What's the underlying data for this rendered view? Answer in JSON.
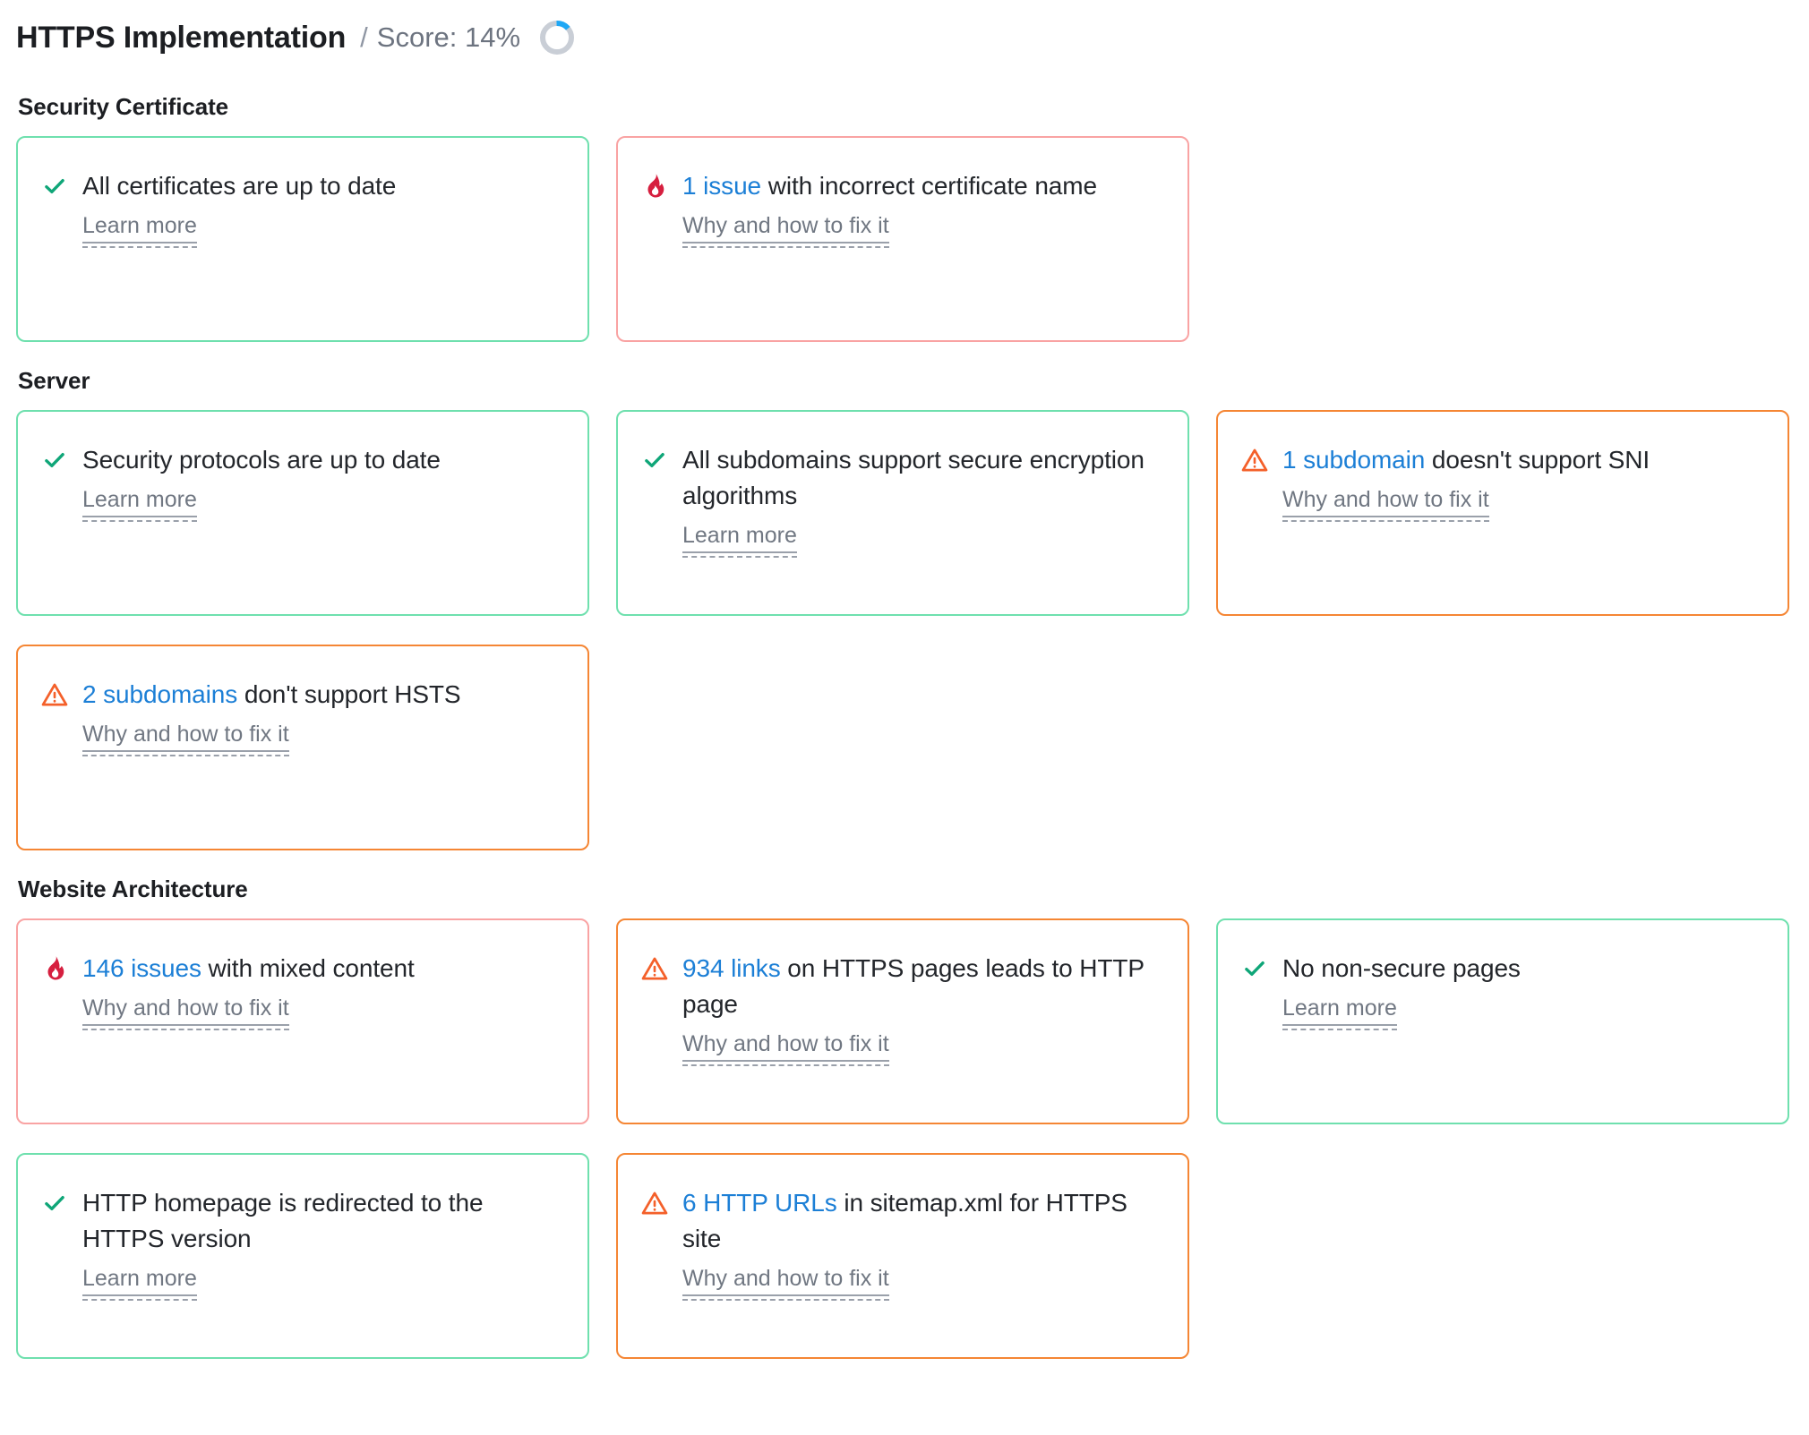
{
  "header": {
    "title": "HTTPS Implementation",
    "separator": "/",
    "score_label": "Score: 14%",
    "score_percent": 14,
    "ring_track_color": "#c9ced6",
    "ring_value_color": "#1ea7f5"
  },
  "colors": {
    "ok_border": "#6fe0ae",
    "error_border": "#f9a3a3",
    "warn_border": "#f58634",
    "check_icon": "#0fa678",
    "flame_icon": "#d61f3f",
    "warn_icon": "#f4602a",
    "link_blue": "#1c7fd6",
    "text_dark": "#23262b",
    "text_muted": "#707782"
  },
  "links": {
    "learn_more": "Learn more",
    "why_and_how": "Why and how to fix it"
  },
  "sections": [
    {
      "title": "Security Certificate",
      "cards": [
        {
          "status": "ok",
          "icon": "check-icon",
          "count": "",
          "text": "All certificates are up to date",
          "link": "Learn more"
        },
        {
          "status": "error",
          "icon": "flame-icon",
          "count": "1 issue",
          "text": " with incorrect certificate name",
          "link": "Why and how to fix it"
        }
      ]
    },
    {
      "title": "Server",
      "cards": [
        {
          "status": "ok",
          "icon": "check-icon",
          "count": "",
          "text": "Security protocols are up to date",
          "link": "Learn more"
        },
        {
          "status": "ok",
          "icon": "check-icon",
          "count": "",
          "text": "All subdomains support secure encryption algorithms",
          "link": "Learn more"
        },
        {
          "status": "warn",
          "icon": "warning-triangle-icon",
          "count": "1 subdomain",
          "text": " doesn't support SNI",
          "link": "Why and how to fix it"
        },
        {
          "status": "warn",
          "icon": "warning-triangle-icon",
          "count": "2 subdomains",
          "text": " don't support HSTS",
          "link": "Why and how to fix it"
        }
      ]
    },
    {
      "title": "Website Architecture",
      "cards": [
        {
          "status": "error",
          "icon": "flame-icon",
          "count": "146 issues",
          "text": " with mixed content",
          "link": "Why and how to fix it"
        },
        {
          "status": "warn",
          "icon": "warning-triangle-icon",
          "count": "934 links",
          "text": " on HTTPS pages leads to HTTP page",
          "link": "Why and how to fix it"
        },
        {
          "status": "ok",
          "icon": "check-icon",
          "count": "",
          "text": "No non-secure pages",
          "link": "Learn more"
        },
        {
          "status": "ok",
          "icon": "check-icon",
          "count": "",
          "text": "HTTP homepage is redirected to the HTTPS version",
          "link": "Learn more"
        },
        {
          "status": "warn",
          "icon": "warning-triangle-icon",
          "count": "6 HTTP URLs",
          "text": " in sitemap.xml for HTTPS site",
          "link": "Why and how to fix it"
        }
      ]
    }
  ]
}
